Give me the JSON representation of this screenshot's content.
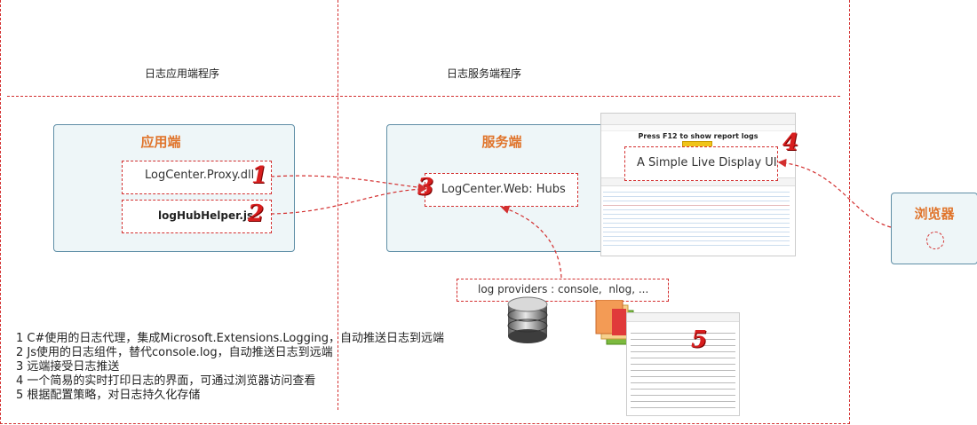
{
  "columns": {
    "left_label": "日志应用端程序",
    "right_label": "日志服务端程序"
  },
  "app_box": {
    "title": "应用端",
    "proxy": "LogCenter.Proxy.dll",
    "helper": "logHubHelper.js"
  },
  "server_box": {
    "title": "服务端",
    "hubs": "LogCenter.Web: Hubs"
  },
  "display": {
    "banner": "Press F12 to show report logs",
    "ui_label": "A Simple Live Display UI"
  },
  "browser_box": {
    "title": "浏览器"
  },
  "providers": "log providers : console,  nlog, ...",
  "markers": [
    "1",
    "2",
    "3",
    "4",
    "5"
  ],
  "notes": [
    "1 C#使用的日志代理，集成Microsoft.Extensions.Logging，自动推送日志到远端",
    "2 Js使用的日志组件，替代console.log，自动推送日志到远端",
    "3 远端接受日志推送",
    "4 一个简易的实时打印日志的界面，可通过浏览器访问查看",
    "5 根据配置策略，对日志持久化存储"
  ],
  "colors": {
    "accent_orange": "#e0742b",
    "dashed_red": "#d32f2f",
    "box_fill": "#eef6f8",
    "box_border": "#5f8ea6"
  }
}
